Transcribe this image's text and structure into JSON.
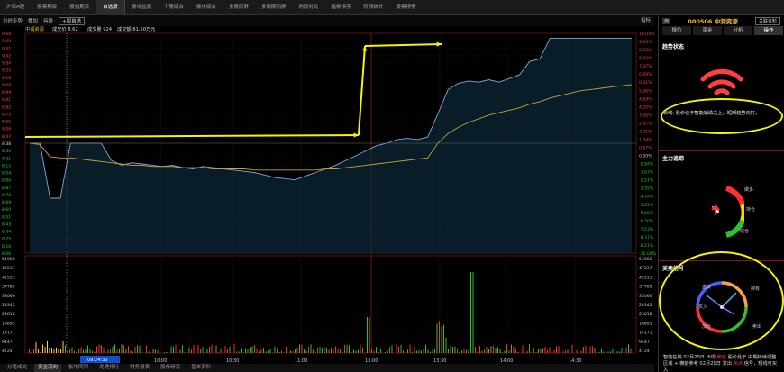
{
  "nav": {
    "tabs": [
      "沪深A股",
      "股票期权",
      "股指期货",
      "自选股",
      "板块监测",
      "个股综合",
      "板块综合",
      "多股同屏",
      "多周期同屏",
      "两股对比",
      "指标排序",
      "阶段统计",
      "股票持警"
    ],
    "active_index": 3
  },
  "toolbar": {
    "period": "分时走势",
    "overlay": "叠加",
    "hold": "持股",
    "add_watch": "+加自选",
    "indicator": "指标"
  },
  "chart_header": {
    "name": "中润资源",
    "price_label": "成交价 8.62",
    "volume_label": "成交量 924",
    "amount_label": "成交额 81.50万元"
  },
  "chart_data": {
    "type": "line",
    "price_axis": [
      "9.68",
      "9.60",
      "9.51",
      "9.42",
      "9.34",
      "9.25",
      "9.16",
      "9.08",
      "8.99",
      "8.91",
      "8.82",
      "8.73",
      "8.65",
      "8.56",
      "8.47",
      "8.38",
      "8.30",
      "8.21",
      "8.12",
      "8.04",
      "7.96",
      "7.88",
      "7.79",
      "7.70",
      "7.62",
      "7.53",
      "7.44",
      "7.36",
      "7.27",
      "7.18",
      "7.10"
    ],
    "pct_axis": [
      "10.04%",
      "9.36%",
      "8.72%",
      "8.04%",
      "7.37%",
      "6.69%",
      "6.01%",
      "5.35%",
      "4.69%",
      "4.02%",
      "3.35%",
      "2.67%",
      "2.01%",
      "1.34%",
      "0.67%",
      "0.00%",
      "-0.67%",
      "-1.34%",
      "-2.01%",
      "-2.67%",
      "-3.35%",
      "-4.02%",
      "-4.69%",
      "-5.35%",
      "-6.01%",
      "-6.69%",
      "-7.37%",
      "-8.04%",
      "-8.72%",
      "-9.36%",
      "-10.04%"
    ],
    "price_y_labels": [
      "9.68",
      "9.60",
      "9.51",
      "9.42",
      "9.34",
      "9.25",
      "9.16",
      "9.08",
      "8.99",
      "8.91",
      "8.82",
      "8.73",
      "8.65",
      "8.56",
      "8.47",
      "8.38",
      "8.30",
      "8.21",
      "8.12",
      "8.04",
      "8.96",
      "8.87",
      "8.78",
      "8.69",
      "8.60",
      "8.51",
      "8.43",
      "8.34",
      "8.25",
      "8.16",
      "8.06"
    ],
    "pct_y_labels": [
      "10.04%",
      "9.26%",
      "8.72%",
      "8.05%",
      "7.37%",
      "6.69%",
      "6.01%",
      "5.36%",
      "4.69%",
      "4.02%",
      "3.35%",
      "2.67%",
      "2.01%",
      "1.34%",
      "0.67%",
      "0.00%",
      "-0.84%",
      "-1.67%",
      "-2.51%",
      "-3.35%",
      "-4.18%",
      "-5.02%",
      "-5.86%",
      "-6.70%",
      "-7.53%",
      "-8.37%",
      "-9.21%",
      "-10.04%"
    ],
    "volume_axis": [
      "51960",
      "47237",
      "42513",
      "37789",
      "33066",
      "28342",
      "23618",
      "18895",
      "14171",
      "9447",
      "4724"
    ],
    "time_labels": [
      "10:00",
      "10:30",
      "11:00",
      "13:00",
      "13:30",
      "14:00",
      "14:30"
    ],
    "cursor_time": "09:24:30",
    "prev_close": 8.96,
    "price_range": [
      8.06,
      9.86
    ],
    "price_series": [
      8.96,
      8.96,
      8.51,
      8.51,
      8.96,
      8.96,
      8.96,
      8.96,
      8.82,
      8.78,
      8.8,
      8.79,
      8.78,
      8.77,
      8.78,
      8.76,
      8.75,
      8.77,
      8.76,
      8.75,
      8.74,
      8.73,
      8.72,
      8.7,
      8.68,
      8.67,
      8.66,
      8.69,
      8.72,
      8.75,
      8.78,
      8.82,
      8.86,
      8.9,
      8.94,
      8.96,
      8.99,
      9.0,
      8.99,
      9.01,
      9.2,
      9.4,
      9.45,
      9.47,
      9.46,
      9.48,
      9.46,
      9.49,
      9.52,
      9.63,
      9.65,
      9.82,
      9.82,
      9.82,
      9.82,
      9.82,
      9.82,
      9.82,
      9.82,
      9.82
    ],
    "avg_series": [
      8.96,
      8.95,
      8.85,
      8.84,
      8.84,
      8.83,
      8.82,
      8.81,
      8.8,
      8.79,
      8.78,
      8.78,
      8.77,
      8.77,
      8.77,
      8.76,
      8.76,
      8.76,
      8.75,
      8.75,
      8.75,
      8.75,
      8.74,
      8.74,
      8.74,
      8.74,
      8.74,
      8.74,
      8.74,
      8.75,
      8.75,
      8.76,
      8.77,
      8.78,
      8.79,
      8.8,
      8.81,
      8.82,
      8.83,
      8.84,
      8.96,
      9.04,
      9.09,
      9.13,
      9.16,
      9.19,
      9.21,
      9.23,
      9.25,
      9.28,
      9.3,
      9.33,
      9.35,
      9.37,
      9.39,
      9.4,
      9.41,
      9.42,
      9.43,
      9.44
    ]
  },
  "sidebar": {
    "code": "000506 中润资源",
    "tag": "自",
    "btn": "关联资料",
    "tabs": [
      "报价",
      "资金",
      "分析",
      "操作"
    ],
    "active_tab": 3,
    "trend_title": "趋势状态",
    "trend_text": "日线: 股价位于智能辅助之上，短期趋势向好。",
    "main_title": "主力追踪",
    "gauge_labels": [
      "做多",
      "持仓",
      "减仓"
    ],
    "buysell_title": "买卖信号",
    "clock_labels": [
      "盘又",
      "买入",
      "持有",
      "卖出",
      "加仓"
    ],
    "msg_pre": "智能狂线  02月20日  出现",
    "msg_red1": "偏空",
    "msg_mid": "股价处于",
    "msg_tail": "中期持续调整区域 + 横前参考  02月20日  发出",
    "msg_red2": "买点",
    "msg_end": "信号，短线可买入"
  },
  "bottom": {
    "tabs": [
      "分笔成交",
      "资金流向",
      "板块同列",
      "龙虎排行",
      "财务报表",
      "股东研究",
      "基本资料"
    ],
    "active_index": 1
  },
  "colors": {
    "up": "#ff3030",
    "down": "#00c000",
    "price_line": "#7fa8d0",
    "avg_line": "#c8a040",
    "annotation": "#f5f500"
  }
}
